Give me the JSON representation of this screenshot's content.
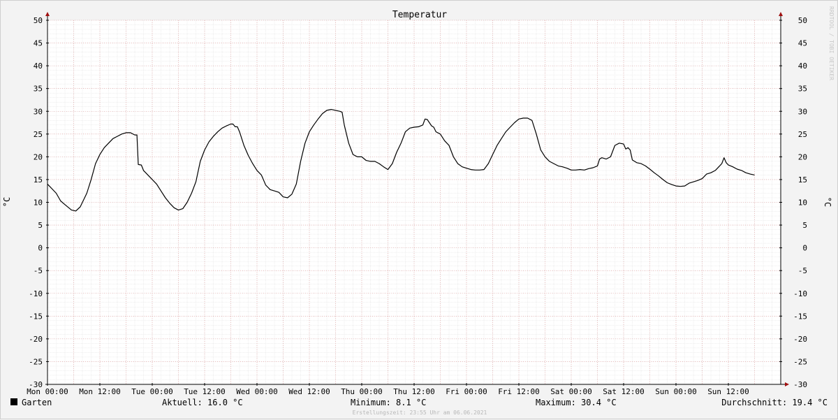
{
  "colors": {
    "background": "#f3f3f3",
    "canvas": "#ffffff",
    "minor_grid": "#dedede",
    "major_grid": "#e59a9a",
    "axis": "#000000",
    "arrow": "#a01010",
    "series": "#000000",
    "watermark": "#c8c8c8"
  },
  "watermark": "RRDTOOL / TOBI OETIKER",
  "created_text": "Erstellungszeit: 23:55 Uhr am 06.06.2021",
  "stats": {
    "current": "Aktuell: 16.0 °C",
    "minimum": "Minimum: 8.1 °C",
    "maximum": "Maximum: 30.4 °C",
    "average": "Durchschnitt: 19.4 °C"
  },
  "chart_data": {
    "type": "line",
    "title": "Temperatur",
    "ylabel": "°C",
    "ylabel_right": "°C",
    "ylim": [
      -30,
      50
    ],
    "yticks": [
      50,
      45,
      40,
      35,
      30,
      25,
      20,
      15,
      10,
      5,
      0,
      -5,
      -10,
      -15,
      -20,
      -25,
      -30
    ],
    "xlim_hours": [
      0,
      168
    ],
    "xticks": [
      {
        "hour": 0,
        "label": "Mon 00:00"
      },
      {
        "hour": 12,
        "label": "Mon 12:00"
      },
      {
        "hour": 24,
        "label": "Tue 00:00"
      },
      {
        "hour": 36,
        "label": "Tue 12:00"
      },
      {
        "hour": 48,
        "label": "Wed 00:00"
      },
      {
        "hour": 60,
        "label": "Wed 12:00"
      },
      {
        "hour": 72,
        "label": "Thu 00:00"
      },
      {
        "hour": 84,
        "label": "Thu 12:00"
      },
      {
        "hour": 96,
        "label": "Fri 00:00"
      },
      {
        "hour": 108,
        "label": "Fri 12:00"
      },
      {
        "hour": 120,
        "label": "Sat 00:00"
      },
      {
        "hour": 132,
        "label": "Sat 12:00"
      },
      {
        "hour": 144,
        "label": "Sun 00:00"
      },
      {
        "hour": 156,
        "label": "Sun 12:00"
      }
    ],
    "grid": true,
    "legend": "bottom-left",
    "series": [
      {
        "name": "Garten",
        "color": "#000000",
        "points": [
          [
            0,
            14
          ],
          [
            1,
            13
          ],
          [
            2,
            12
          ],
          [
            3,
            10.3
          ],
          [
            4,
            9.5
          ],
          [
            5.5,
            8.3
          ],
          [
            6.5,
            8.1
          ],
          [
            7.5,
            9
          ],
          [
            9,
            12
          ],
          [
            10,
            15
          ],
          [
            11,
            18.5
          ],
          [
            12,
            20.5
          ],
          [
            13,
            22
          ],
          [
            14,
            23
          ],
          [
            15,
            24
          ],
          [
            16,
            24.5
          ],
          [
            17,
            25
          ],
          [
            18,
            25.3
          ],
          [
            19,
            25.3
          ],
          [
            20,
            24.8
          ],
          [
            20.5,
            24.8
          ],
          [
            20.8,
            18.3
          ],
          [
            21.5,
            18.2
          ],
          [
            22,
            17
          ],
          [
            23.5,
            15.5
          ],
          [
            25,
            14
          ],
          [
            26,
            12.5
          ],
          [
            27,
            11
          ],
          [
            28,
            9.8
          ],
          [
            29,
            8.8
          ],
          [
            30,
            8.3
          ],
          [
            31,
            8.6
          ],
          [
            32,
            10
          ],
          [
            33,
            12
          ],
          [
            34,
            14.5
          ],
          [
            35,
            19
          ],
          [
            36,
            21.5
          ],
          [
            37,
            23.3
          ],
          [
            38,
            24.5
          ],
          [
            39,
            25.5
          ],
          [
            40,
            26.3
          ],
          [
            41,
            26.8
          ],
          [
            42,
            27.2
          ],
          [
            42.5,
            27.2
          ],
          [
            43,
            26.6
          ],
          [
            43.5,
            26.6
          ],
          [
            44,
            25.5
          ],
          [
            45,
            22.5
          ],
          [
            46,
            20.3
          ],
          [
            47,
            18.5
          ],
          [
            48,
            17
          ],
          [
            49,
            16
          ],
          [
            50,
            13.8
          ],
          [
            51,
            12.8
          ],
          [
            52,
            12.5
          ],
          [
            53,
            12.2
          ],
          [
            54,
            11.2
          ],
          [
            55,
            11
          ],
          [
            56,
            11.8
          ],
          [
            57,
            14
          ],
          [
            58,
            19
          ],
          [
            59,
            23
          ],
          [
            60,
            25.5
          ],
          [
            61,
            27
          ],
          [
            62,
            28.3
          ],
          [
            63,
            29.5
          ],
          [
            64,
            30.2
          ],
          [
            65,
            30.4
          ],
          [
            66,
            30.2
          ],
          [
            67,
            30
          ],
          [
            67.5,
            29.8
          ],
          [
            68,
            27
          ],
          [
            69,
            23
          ],
          [
            70,
            20.5
          ],
          [
            71,
            20
          ],
          [
            72,
            20
          ],
          [
            73,
            19.2
          ],
          [
            74,
            19
          ],
          [
            75,
            19
          ],
          [
            76,
            18.5
          ],
          [
            77,
            17.8
          ],
          [
            78,
            17.2
          ],
          [
            79,
            18.5
          ],
          [
            80,
            21
          ],
          [
            81,
            23
          ],
          [
            82,
            25.5
          ],
          [
            83,
            26.3
          ],
          [
            84,
            26.5
          ],
          [
            85,
            26.6
          ],
          [
            86,
            27
          ],
          [
            86.5,
            28.3
          ],
          [
            87,
            28.2
          ],
          [
            88,
            26.8
          ],
          [
            88.5,
            26.5
          ],
          [
            89,
            25.5
          ],
          [
            90,
            25
          ],
          [
            91,
            23.5
          ],
          [
            92,
            22.5
          ],
          [
            93,
            20
          ],
          [
            94,
            18.5
          ],
          [
            95,
            17.8
          ],
          [
            96,
            17.5
          ],
          [
            97,
            17.2
          ],
          [
            98,
            17.1
          ],
          [
            99,
            17.1
          ],
          [
            100,
            17.2
          ],
          [
            101,
            18.5
          ],
          [
            102,
            20.5
          ],
          [
            103,
            22.5
          ],
          [
            104,
            24
          ],
          [
            105,
            25.5
          ],
          [
            106,
            26.5
          ],
          [
            107,
            27.5
          ],
          [
            108,
            28.3
          ],
          [
            109,
            28.5
          ],
          [
            110,
            28.5
          ],
          [
            111,
            28
          ],
          [
            112,
            25
          ],
          [
            113,
            21.5
          ],
          [
            114,
            20
          ],
          [
            115,
            19
          ],
          [
            116,
            18.5
          ],
          [
            117,
            18
          ],
          [
            118,
            17.8
          ],
          [
            119,
            17.5
          ],
          [
            120,
            17.1
          ],
          [
            121,
            17.1
          ],
          [
            122,
            17.2
          ],
          [
            123,
            17.1
          ],
          [
            124,
            17.4
          ],
          [
            125,
            17.6
          ],
          [
            126,
            18
          ],
          [
            126.5,
            19.5
          ],
          [
            127,
            19.8
          ],
          [
            128,
            19.5
          ],
          [
            129,
            20
          ],
          [
            130,
            22.5
          ],
          [
            131,
            23
          ],
          [
            132,
            22.8
          ],
          [
            132.5,
            21.7
          ],
          [
            133,
            22
          ],
          [
            133.5,
            21.5
          ],
          [
            134,
            19.3
          ],
          [
            135,
            18.7
          ],
          [
            136,
            18.5
          ],
          [
            137,
            18
          ],
          [
            138,
            17.3
          ],
          [
            139,
            16.5
          ],
          [
            140,
            15.8
          ],
          [
            141,
            15
          ],
          [
            142,
            14.3
          ],
          [
            143,
            13.9
          ],
          [
            144,
            13.6
          ],
          [
            145,
            13.5
          ],
          [
            146,
            13.6
          ],
          [
            147,
            14.2
          ],
          [
            148,
            14.5
          ],
          [
            149,
            14.8
          ],
          [
            150,
            15.2
          ],
          [
            151,
            16.2
          ],
          [
            152,
            16.5
          ],
          [
            153,
            17
          ],
          [
            154,
            18
          ],
          [
            154.5,
            18.5
          ],
          [
            155,
            19.8
          ],
          [
            155.5,
            18.7
          ],
          [
            156,
            18.2
          ],
          [
            157,
            17.8
          ],
          [
            158,
            17.3
          ],
          [
            159,
            17
          ],
          [
            160,
            16.5
          ],
          [
            161,
            16.2
          ],
          [
            162,
            16
          ]
        ]
      }
    ]
  }
}
